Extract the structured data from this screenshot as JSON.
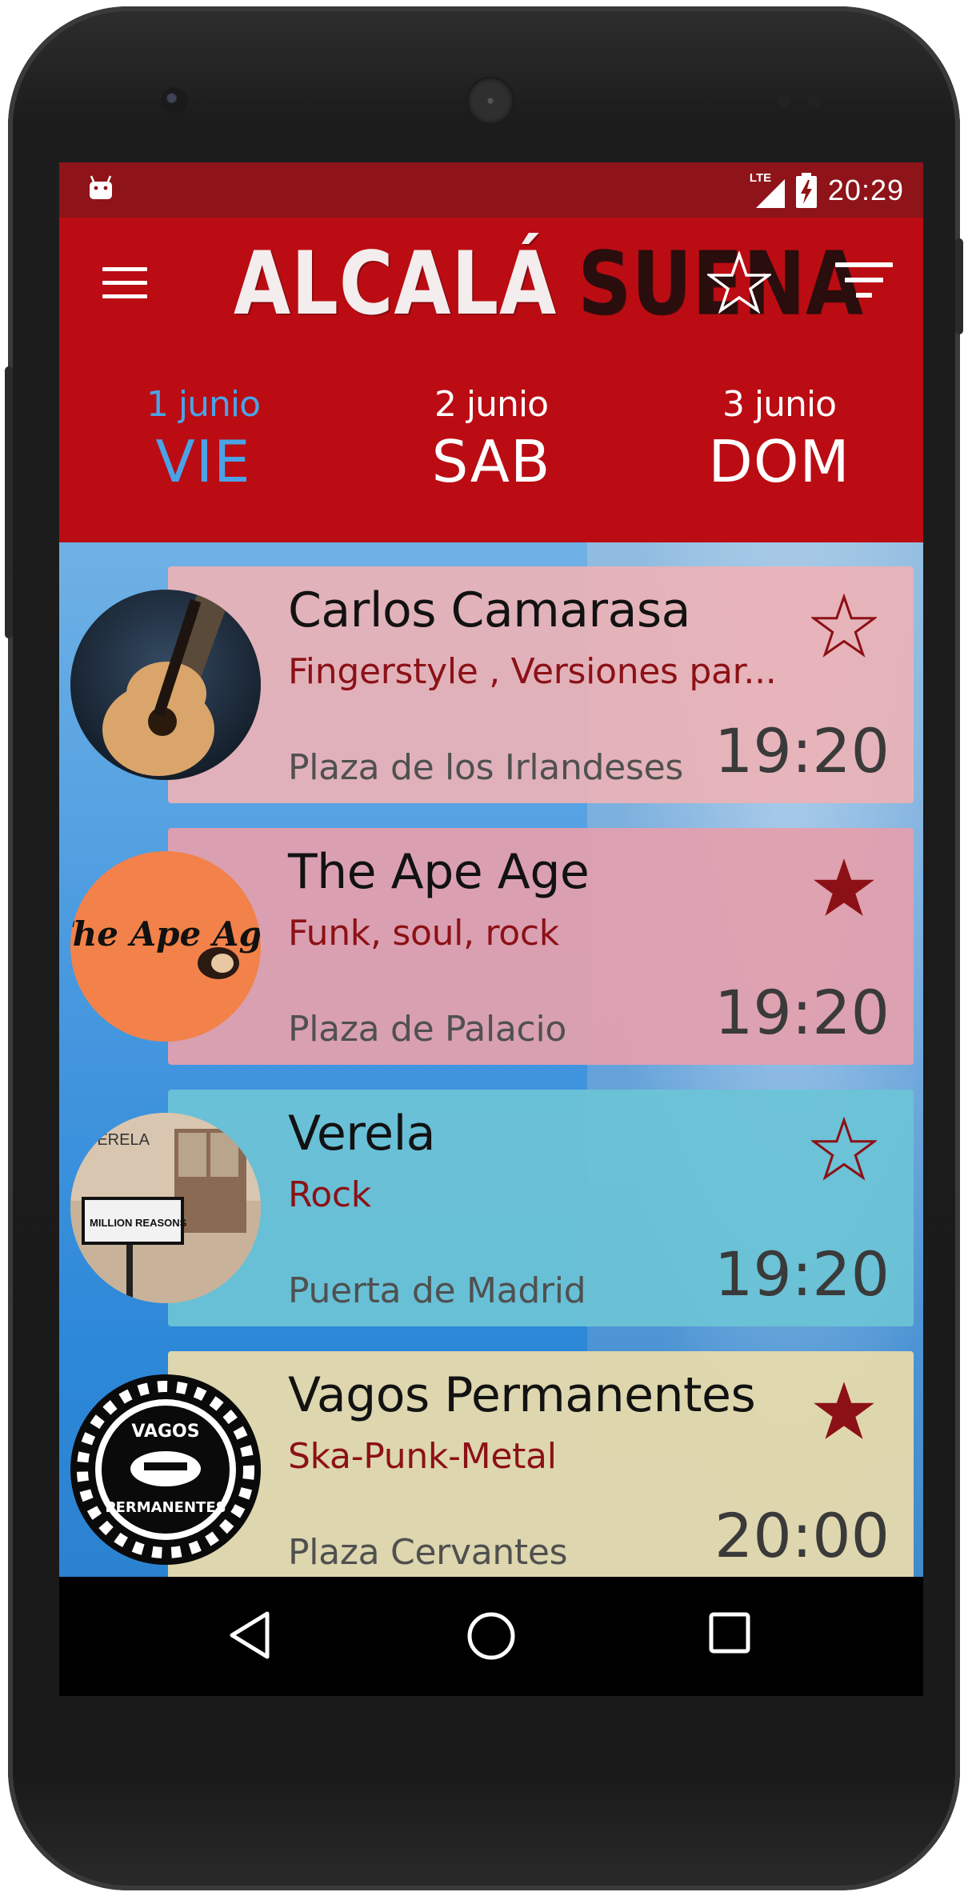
{
  "status_bar": {
    "network_label": "LTE",
    "time": "20:29"
  },
  "app_bar": {
    "logo_word1": "ALCALÁ",
    "logo_word2": "SUENA",
    "colors": {
      "primary": "#bb0c13",
      "status": "#8e1419",
      "accent": "#4aa3e6"
    }
  },
  "tabs": [
    {
      "date": "1 junio",
      "day": "VIE",
      "active": true
    },
    {
      "date": "2 junio",
      "day": "SAB",
      "active": false
    },
    {
      "date": "3 junio",
      "day": "DOM",
      "active": false
    }
  ],
  "events": [
    {
      "name": "Carlos Camarasa",
      "genre": "Fingerstyle , Versiones par...",
      "venue": "Plaza de los Irlandeses",
      "time": "19:20",
      "favorite": false,
      "card_color": "#e6b1b6"
    },
    {
      "name": "The Ape Age",
      "genre": "Funk, soul, rock",
      "venue": "Plaza de Palacio",
      "time": "19:20",
      "favorite": true,
      "card_color": "#dfa1ae",
      "avatar_text": "The Ape Age"
    },
    {
      "name": "Verela",
      "genre": "Rock",
      "venue": "Puerta de Madrid",
      "time": "19:20",
      "favorite": false,
      "card_color": "#6cc3d6",
      "avatar_text": [
        "VERELA",
        "MILLION REASONS"
      ]
    },
    {
      "name": "Vagos Permanentes",
      "genre": "Ska-Punk-Metal",
      "venue": "Plaza Cervantes",
      "time": "20:00",
      "favorite": true,
      "card_color": "#e3d9ac",
      "avatar_text": [
        "VAGOS",
        "PERMANENTES"
      ]
    }
  ],
  "icons": {
    "menu": "hamburger-icon",
    "favorites": "star-outline-icon",
    "filter": "filter-icon",
    "nav": [
      "back-triangle-icon",
      "home-circle-icon",
      "recents-square-icon"
    ]
  }
}
